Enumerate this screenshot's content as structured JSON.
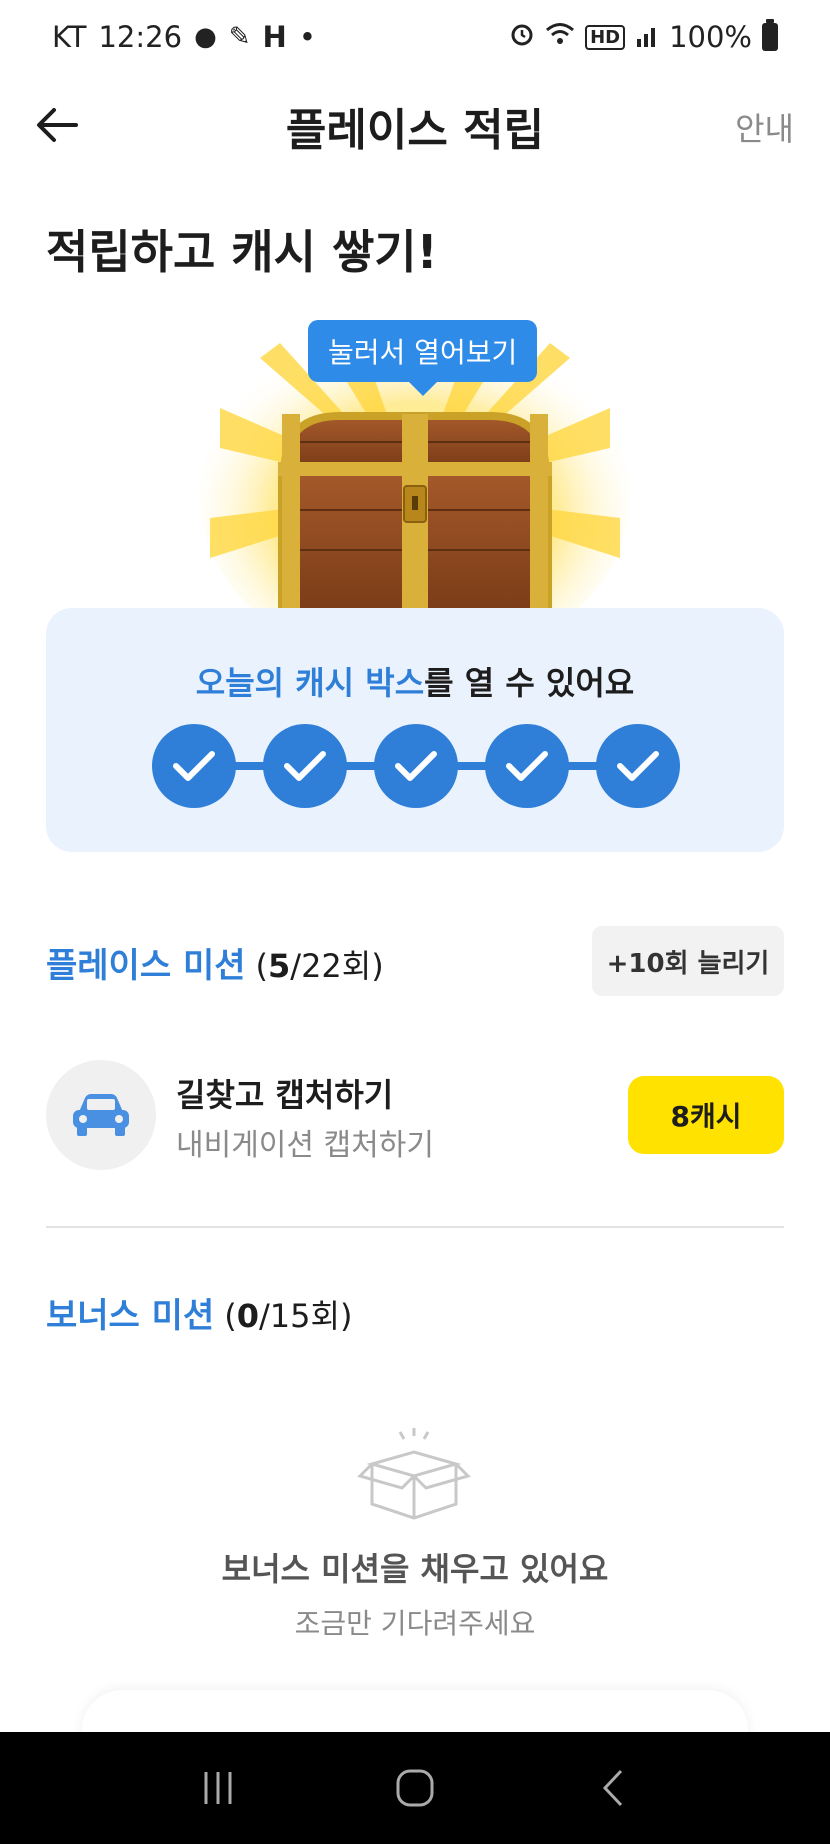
{
  "status_bar": {
    "carrier": "KT",
    "time": "12:26",
    "h_indicator": "H",
    "dot": "•",
    "hd_label": "HD",
    "battery": "100%",
    "icons": [
      "messenger-icon",
      "pen-icon",
      "alarm-icon",
      "wifi-icon",
      "signal-icon",
      "battery-icon"
    ]
  },
  "header": {
    "title": "플레이스 적립",
    "info": "안내"
  },
  "headline": "적립하고 캐시 쌓기!",
  "chest": {
    "tooltip": "눌러서 열어보기"
  },
  "cash_box": {
    "title_accent": "오늘의 캐시 박스",
    "title_rest": "를 열 수 있어요",
    "steps_completed": 5,
    "steps_total": 5
  },
  "place_mission": {
    "title": "플레이스 미션",
    "count_done": "5",
    "count_total": "/22회)",
    "count_open": "(",
    "extend_label": "+10회 늘리기",
    "items": [
      {
        "title": "길찾고 캡처하기",
        "subtitle": "내비게이션 캡처하기",
        "reward": "8캐시",
        "icon": "car-icon"
      }
    ]
  },
  "bonus_mission": {
    "title": "보너스 미션",
    "count_open": "(",
    "count_done": "0",
    "count_total": "/15회)",
    "empty_title": "보너스 미션을 채우고 있어요",
    "empty_sub": "조금만 기다려주세요"
  },
  "colors": {
    "accent_blue": "#2f7fd8",
    "reward_yellow": "#ffe200",
    "card_bg": "#eaf2fd"
  }
}
